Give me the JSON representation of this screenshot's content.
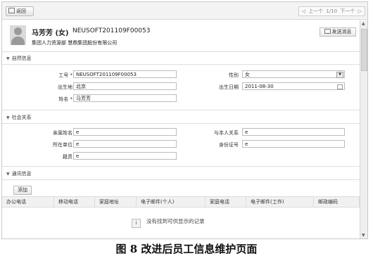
{
  "toolbar": {
    "back_label": "返回",
    "prev_label": "上一个",
    "page": "1/10",
    "next_label": "下一个"
  },
  "employee": {
    "name": "马芳芳 (女)",
    "id": "NEUSOFT201109F00053",
    "subtitle": "集团人力资源部   慧鼎集团股份有限公司",
    "send_message_label": "发送消息"
  },
  "natural_info": {
    "title": "自然信息",
    "fields": {
      "job_no_label": "工号 *",
      "job_no_value": "NEUSOFT201109F00053",
      "gender_label": "性别",
      "gender_value": "女",
      "birthplace_label": "出生地",
      "birthplace_value": "北京",
      "birthdate_label": "出生日期",
      "birthdate_value": "2011-08-30",
      "name_label": "姓名 *",
      "name_value": "马芳芳"
    }
  },
  "social": {
    "title": "社会关系",
    "fields": {
      "relative_name_label": "亲属姓名",
      "relative_name_value": "e",
      "relation_label": "与本人关系",
      "relation_value": "e",
      "workplace_label": "所在单位",
      "workplace_value": "e",
      "id_card_label": "身份证号",
      "id_card_value": "e",
      "native_label": "籍贯",
      "native_value": "e"
    }
  },
  "contact": {
    "title": "通讯信息",
    "add_label": "添加",
    "columns": [
      "办公电话",
      "移动电话",
      "家庭地址",
      "电子邮件(个人)",
      "家庭电话",
      "电子邮件(工作)",
      "邮政编码"
    ],
    "empty_text": "没有找到可供显示的记录"
  },
  "caption": "图 8 改进后员工信息维护页面"
}
